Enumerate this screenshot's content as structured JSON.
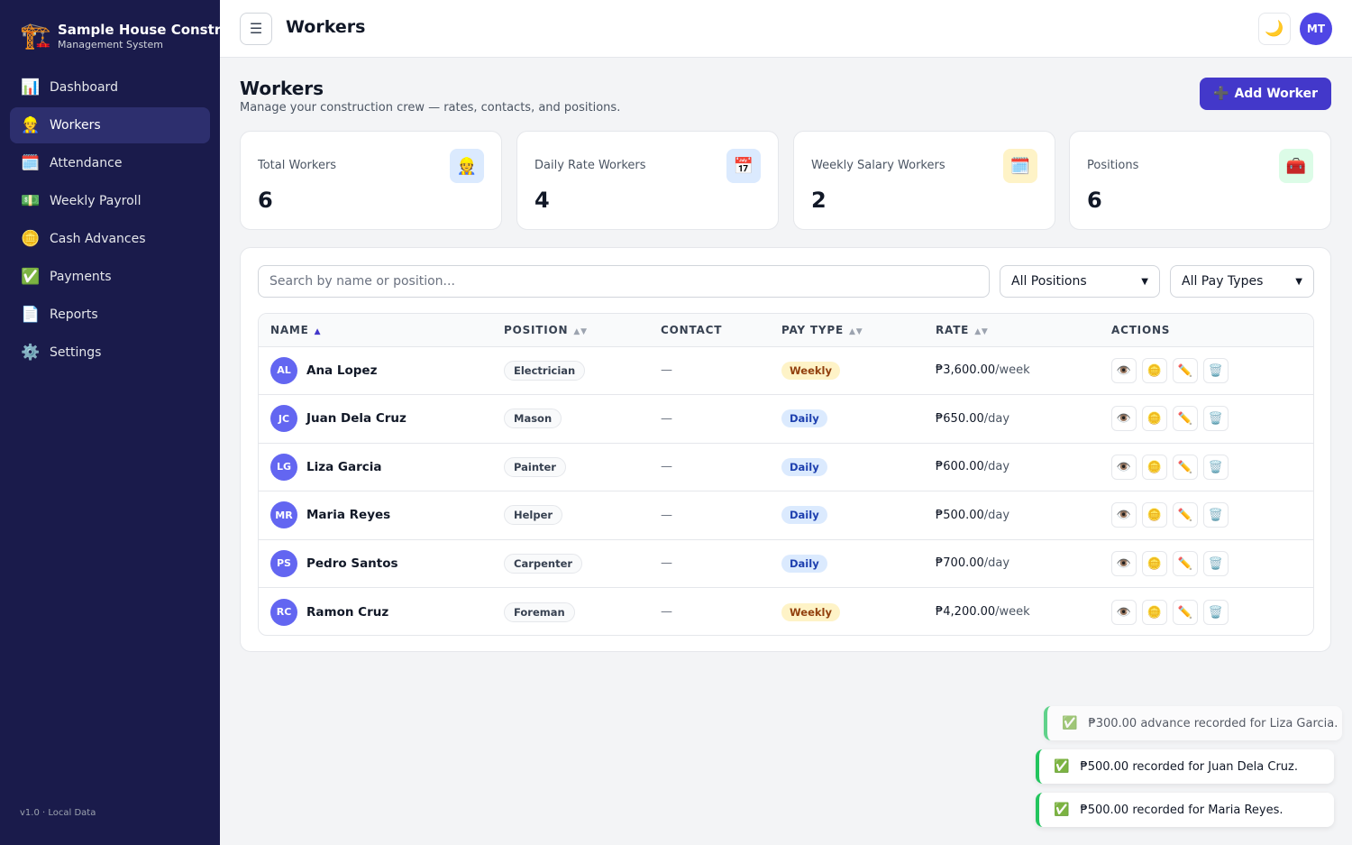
{
  "brand": {
    "icon": "🏗️",
    "name": "Sample House Construction",
    "subtitle": "Management System"
  },
  "sidebar": {
    "items": [
      {
        "icon": "📊",
        "label": "Dashboard"
      },
      {
        "icon": "👷",
        "label": "Workers"
      },
      {
        "icon": "🗓️",
        "label": "Attendance"
      },
      {
        "icon": "💵",
        "label": "Weekly Payroll"
      },
      {
        "icon": "🪙",
        "label": "Cash Advances"
      },
      {
        "icon": "✅",
        "label": "Payments"
      },
      {
        "icon": "📄",
        "label": "Reports"
      },
      {
        "icon": "⚙️",
        "label": "Settings"
      }
    ],
    "active": "Workers",
    "version": "v1.0 · Local Data"
  },
  "topbar": {
    "menu_icon": "☰",
    "title": "Workers",
    "theme_icon": "🌙",
    "avatar": "MT"
  },
  "page": {
    "title": "Workers",
    "subtitle": "Manage your construction crew — rates, contacts, and positions.",
    "add_icon": "➕",
    "add_label": "Add Worker"
  },
  "stats": [
    {
      "label": "Total Workers",
      "value": "6",
      "icon": "👷",
      "icon_bg": "#dbeafe"
    },
    {
      "label": "Daily Rate Workers",
      "value": "4",
      "icon": "📅",
      "icon_bg": "#dbeafe"
    },
    {
      "label": "Weekly Salary Workers",
      "value": "2",
      "icon": "🗓️",
      "icon_bg": "#fef3c7"
    },
    {
      "label": "Positions",
      "value": "6",
      "icon": "🧰",
      "icon_bg": "#dcfce7"
    }
  ],
  "filters": {
    "search_placeholder": "Search by name or position...",
    "position_selected": "All Positions",
    "paytype_selected": "All Pay Types"
  },
  "table": {
    "headers": [
      "NAME",
      "POSITION",
      "CONTACT",
      "PAY TYPE",
      "RATE",
      "ACTIONS"
    ],
    "sort_icons": {
      "asc": "▲",
      "both": "▲▼"
    },
    "action_icons": [
      "👁️",
      "🪙",
      "✏️",
      "🗑️"
    ],
    "rows": [
      {
        "initials": "AL",
        "name": "Ana Lopez",
        "position": "Electrician",
        "contact": "—",
        "pay_type": "Weekly",
        "rate": "₱3,600.00",
        "unit": "/week"
      },
      {
        "initials": "JC",
        "name": "Juan Dela Cruz",
        "position": "Mason",
        "contact": "—",
        "pay_type": "Daily",
        "rate": "₱650.00",
        "unit": "/day"
      },
      {
        "initials": "LG",
        "name": "Liza Garcia",
        "position": "Painter",
        "contact": "—",
        "pay_type": "Daily",
        "rate": "₱600.00",
        "unit": "/day"
      },
      {
        "initials": "MR",
        "name": "Maria Reyes",
        "position": "Helper",
        "contact": "—",
        "pay_type": "Daily",
        "rate": "₱500.00",
        "unit": "/day"
      },
      {
        "initials": "PS",
        "name": "Pedro Santos",
        "position": "Carpenter",
        "contact": "—",
        "pay_type": "Daily",
        "rate": "₱700.00",
        "unit": "/day"
      },
      {
        "initials": "RC",
        "name": "Ramon Cruz",
        "position": "Foreman",
        "contact": "—",
        "pay_type": "Weekly",
        "rate": "₱4,200.00",
        "unit": "/week"
      }
    ]
  },
  "toasts": [
    {
      "icon": "✅",
      "text": "₱300.00 advance recorded for Liza Garcia."
    },
    {
      "icon": "✅",
      "text": "₱500.00 recorded for Juan Dela Cruz."
    },
    {
      "icon": "✅",
      "text": "₱500.00 recorded for Maria Reyes."
    }
  ]
}
